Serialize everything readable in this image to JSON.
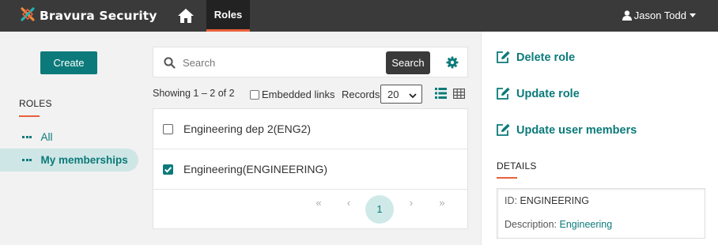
{
  "header": {
    "brand_name": "Bravura Security",
    "nav_home_icon": "home-icon",
    "nav_active": "Roles",
    "user_name": "Jason Todd"
  },
  "colors": {
    "accent": "#0c7a7a",
    "topbar": "#3a3a3a",
    "highlight": "#e8603c"
  },
  "sidebar": {
    "create_label": "Create",
    "heading": "ROLES",
    "items": [
      {
        "label": "All",
        "active": false
      },
      {
        "label": "My memberships",
        "active": true
      }
    ]
  },
  "search": {
    "placeholder": "Search",
    "value": "",
    "button_label": "Search"
  },
  "toolbar": {
    "showing_text": "Showing 1 – 2 of 2",
    "embedded_links_label": "Embedded links",
    "embedded_links_checked": false,
    "records_label": "Records",
    "records_value": "20"
  },
  "list": {
    "rows": [
      {
        "label": "Engineering dep 2(ENG2)",
        "checked": false
      },
      {
        "label": "Engineering(ENGINEERING)",
        "checked": true
      }
    ]
  },
  "pagination": {
    "first": "«",
    "prev": "‹",
    "current": "1",
    "next": "›",
    "last": "»"
  },
  "actions": {
    "delete_role": "Delete role",
    "update_role": "Update role",
    "update_user_members": "Update user members"
  },
  "details": {
    "heading": "DETAILS",
    "id_label": "ID:",
    "id_value": "ENGINEERING",
    "description_label": "Description:",
    "description_value": "Engineering"
  }
}
